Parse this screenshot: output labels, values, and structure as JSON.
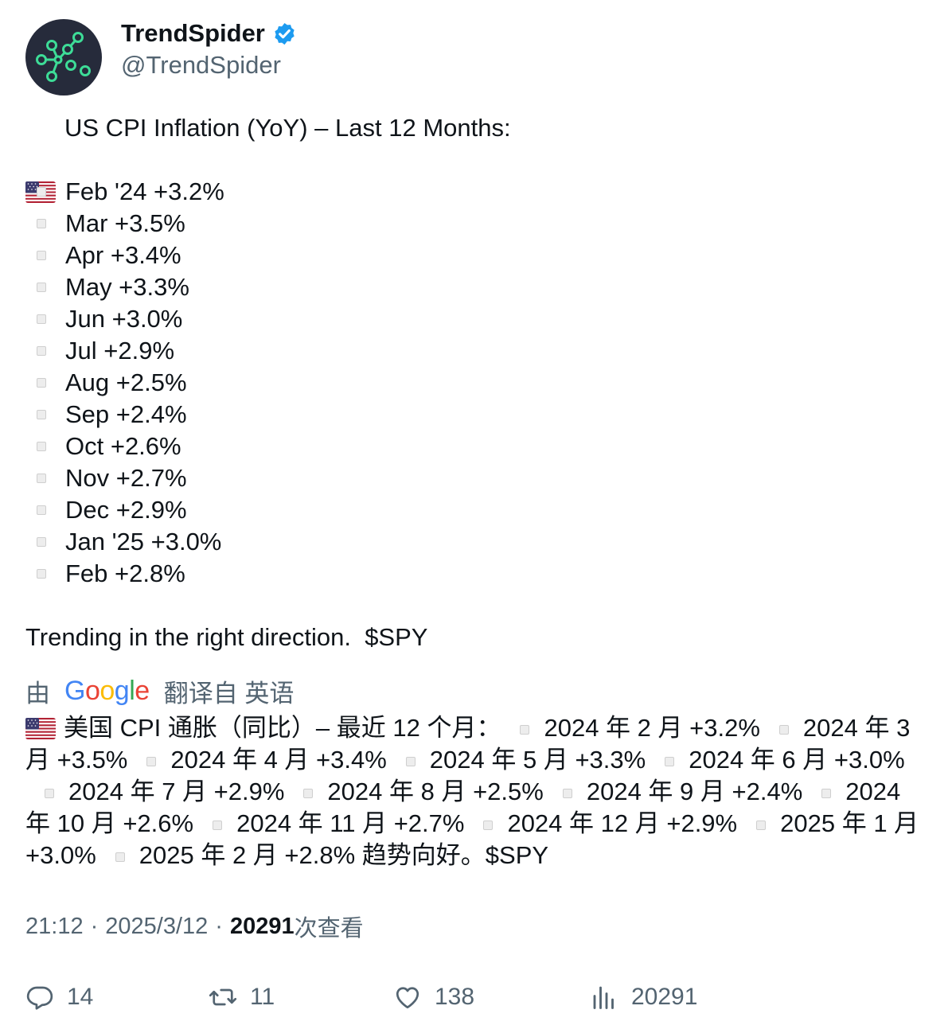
{
  "author": {
    "display_name": "TrendSpider",
    "handle": "@TrendSpider",
    "verified": true,
    "avatar_icon": "trendspider-logo-icon",
    "badge_color": "#1d9bf0"
  },
  "tweet": {
    "headline": "US CPI Inflation (YoY) – Last 12 Months:",
    "items": [
      "Feb '24 +3.2%",
      "Mar +3.5%",
      "Apr +3.4%",
      "May +3.3%",
      "Jun +3.0%",
      "Jul +2.9%",
      "Aug +2.5%",
      "Sep +2.4%",
      "Oct +2.6%",
      "Nov +2.7%",
      "Dec +2.9%",
      "Jan '25 +3.0%",
      "Feb +2.8%"
    ],
    "closing": "Trending in the right direction.  $SPY"
  },
  "translation": {
    "prefix": "由",
    "provider": "Google",
    "suffix": "翻译自 英语",
    "headline": "美国 CPI 通胀（同比）– 最近 12 个月：",
    "items": [
      "2024 年 2 月 +3.2%",
      "2024 年 3 月 +3.5%",
      "2024 年 4 月 +3.4%",
      "2024 年 5 月 +3.3%",
      "2024 年 6 月 +3.0%",
      "2024 年 7 月 +2.9%",
      "2024 年 8 月 +2.5%",
      "2024 年 9 月 +2.4%",
      "2024 年 10 月 +2.6%",
      "2024 年 11 月 +2.7%",
      "2024 年 12 月 +2.9%",
      "2025 年 1 月 +3.0%",
      "2025 年 2 月 +2.8% 趋势向好。$SPY"
    ]
  },
  "meta": {
    "time": "21:12",
    "date": "2025/3/12",
    "views_count": "20291",
    "views_label": "次查看"
  },
  "actions": {
    "replies": "14",
    "retweets": "11",
    "likes": "138",
    "views": "20291"
  },
  "colors": {
    "text": "#0f1419",
    "secondary": "#536471",
    "avatar_bg": "#262b3b",
    "logo_green": "#3ddc97"
  }
}
